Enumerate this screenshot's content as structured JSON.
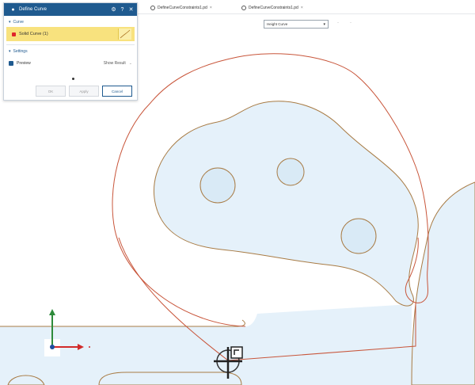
{
  "dialog": {
    "title": "Define Curve",
    "sections": {
      "curve": "Curve",
      "settings": "Settings"
    },
    "curve_item": "Solid Curve (1)",
    "settings_checkbox_label": "Preview",
    "settings_dropdown": "Show Result",
    "buttons": {
      "ok": "OK",
      "apply": "Apply",
      "cancel": "Cancel"
    }
  },
  "tabs": [
    {
      "label": "DefineCurveConstraints1.pd"
    },
    {
      "label": "DefineCurveConstraints1.pd"
    }
  ],
  "toolbar": {
    "sheet_select": "Height Curve"
  },
  "colors": {
    "header_blue": "#1f5a8f",
    "selection_yellow": "#f8e27e",
    "region_fill": "#e5f1fa",
    "region_outline": "#a87b44",
    "curve_red": "#c8553a"
  },
  "icons": {
    "panel_settings": "gear-icon",
    "panel_help": "help-icon",
    "panel_close": "close-icon",
    "tab_file": "file-icon",
    "cursor": "crosshair-cursor-icon"
  }
}
